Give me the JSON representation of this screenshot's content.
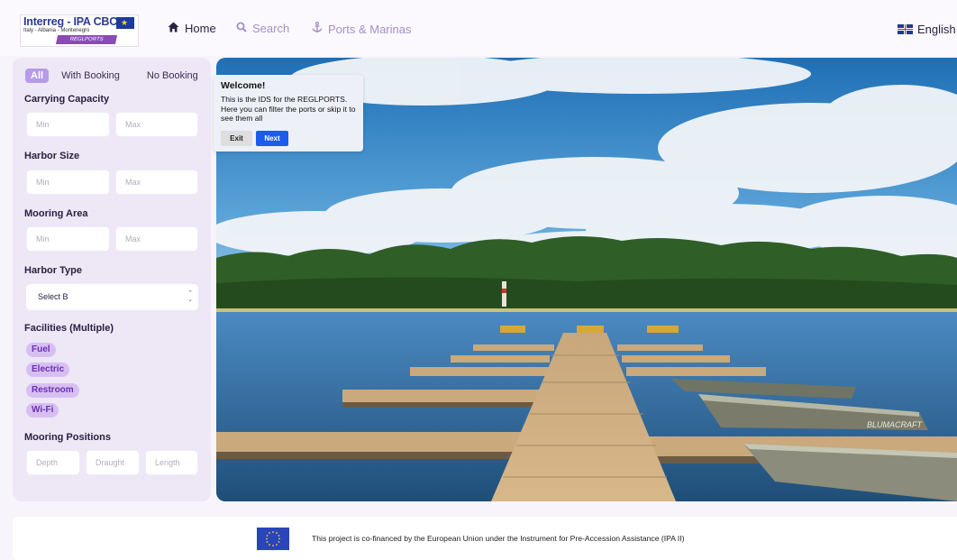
{
  "header": {
    "logo": {
      "title": "Interreg - IPA CBC",
      "subtitle": "Italy - Albania - Montenegro",
      "project": "REGLPORTS"
    },
    "nav": [
      {
        "label": "Home",
        "icon": "home-icon"
      },
      {
        "label": "Search",
        "icon": "search-icon"
      },
      {
        "label": "Ports & Marinas",
        "icon": "anchor-icon"
      }
    ],
    "language": {
      "label": "English",
      "icon": "uk-flag-icon"
    }
  },
  "sidebar": {
    "tabs": [
      {
        "label": "All",
        "active": true
      },
      {
        "label": "With Booking",
        "active": false
      },
      {
        "label": "No Booking",
        "active": false
      }
    ],
    "carrying_capacity": {
      "label": "Carrying Capacity",
      "min_placeholder": "Min",
      "max_placeholder": "Max"
    },
    "harbor_size": {
      "label": "Harbor Size",
      "min_placeholder": "Min",
      "max_placeholder": "Max"
    },
    "mooring_area": {
      "label": "Mooring Area",
      "min_placeholder": "Min",
      "max_placeholder": "Max"
    },
    "harbor_type": {
      "label": "Harbor Type",
      "selected": "Select B"
    },
    "facilities": {
      "label": "Facilities (Multiple)",
      "items": [
        "Fuel",
        "Electric",
        "Restroom",
        "Wi-Fi"
      ]
    },
    "mooring_positions": {
      "label": "Mooring Positions",
      "depth_placeholder": "Depth",
      "draught_placeholder": "Draught",
      "length_placeholder": "Length"
    }
  },
  "tour": {
    "title": "Welcome!",
    "body": "This is the IDS for the REGLPORTS. Here you can filter the ports or skip it to see them all",
    "exit_label": "Exit",
    "next_label": "Next"
  },
  "hero": {
    "boat_text": "BLUMACRAFT"
  },
  "footer": {
    "text": "This project is co-financed by the European Union under the Instrument for Pre-Accession Assistance (IPA II)"
  },
  "colors": {
    "accent": "#b79be8",
    "chip_bg": "#d8bff3",
    "chip_text": "#6a2fb0",
    "next_button": "#1b5bf0",
    "nav_muted": "#a58fc4"
  }
}
